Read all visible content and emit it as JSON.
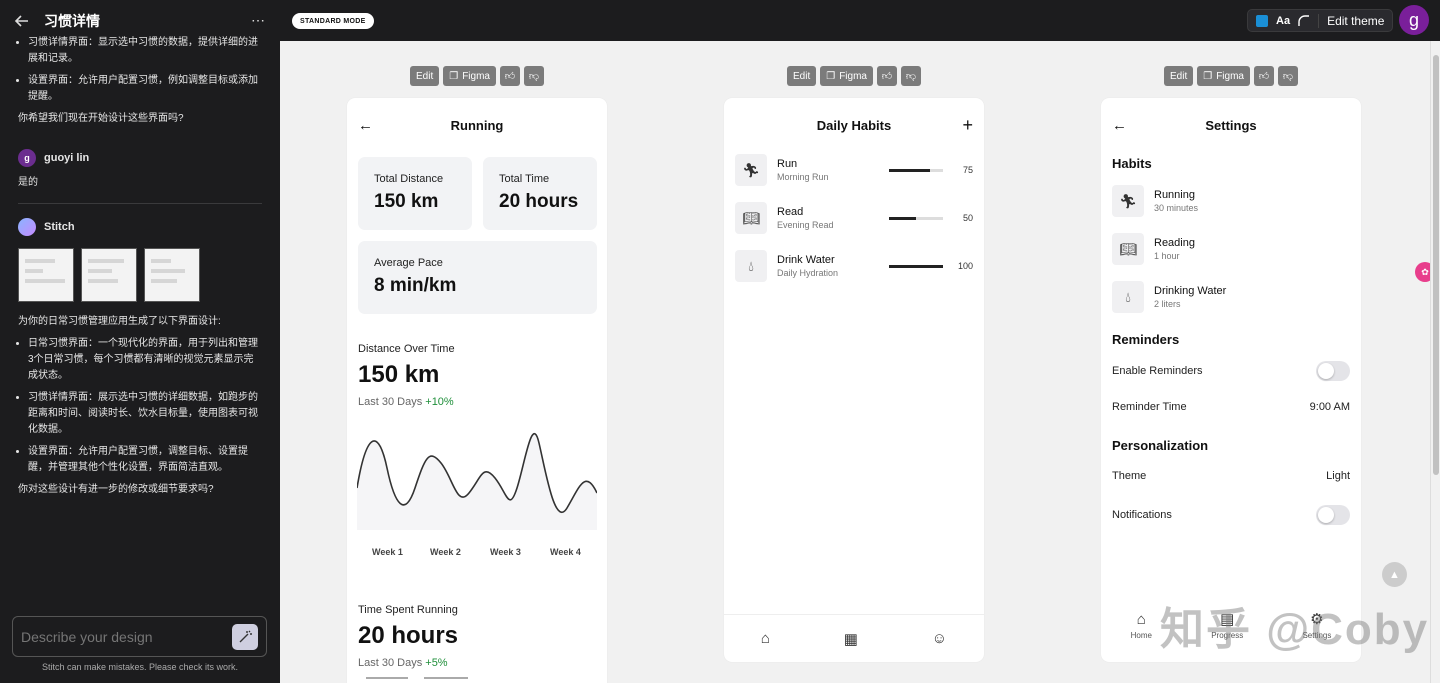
{
  "left_panel": {
    "title": "习惯详情",
    "chat_top": [
      "习惯详情界面：显示选中习惯的数据，提供详细的进展和记录。",
      "设置界面：允许用户配置习惯，例如调整目标或添加提醒。"
    ],
    "question1": "你希望我们现在开始设计这些界面吗?",
    "user_name": "guoyi lin",
    "user_initial": "g",
    "user_msg": "是的",
    "bot_name": "Stitch",
    "intro": "为你的日常习惯管理应用生成了以下界面设计:",
    "bullets": [
      "日常习惯界面：一个现代化的界面，用于列出和管理3个日常习惯，每个习惯都有清晰的视觉元素显示完成状态。",
      "习惯详情界面：展示选中习惯的详细数据，如跑步的距离和时间、阅读时长、饮水目标量，使用图表可视化数据。",
      "设置界面：允许用户配置习惯，调整目标、设置提醒，并管理其他个性化设置，界面简洁直观。"
    ],
    "question2": "你对这些设计有进一步的修改或细节要求吗?",
    "composer_placeholder": "Describe your design",
    "disclaimer": "Stitch can make mistakes. Please check its work."
  },
  "top": {
    "mode_label": "STANDARD MODE",
    "aa_label": "Aa",
    "edit_theme_label": "Edit theme",
    "avatar_initial": "g",
    "swatch_color": "#1a8fd6"
  },
  "toolbar": {
    "edit_label": "Edit",
    "figma_label": "Figma"
  },
  "running": {
    "title": "Running",
    "total_distance_label": "Total Distance",
    "total_distance": "150 km",
    "total_time_label": "Total Time",
    "total_time": "20 hours",
    "pace_label": "Average Pace",
    "pace": "8 min/km",
    "chart1_label": "Distance Over Time",
    "chart1_value": "150 km",
    "chart1_sub": "Last 30 Days",
    "chart1_delta": "+10%",
    "weeks": [
      "Week 1",
      "Week 2",
      "Week 3",
      "Week 4"
    ],
    "chart2_label": "Time Spent Running",
    "chart2_value": "20 hours",
    "chart2_sub": "Last 30 Days",
    "chart2_delta": "+5%"
  },
  "daily": {
    "title": "Daily Habits",
    "habits": [
      {
        "name": "Run",
        "detail": "Morning Run",
        "value": "75",
        "progress": 0.75,
        "icon": "run-icon"
      },
      {
        "name": "Read",
        "detail": "Evening Read",
        "value": "50",
        "progress": 0.5,
        "icon": "book-icon"
      },
      {
        "name": "Drink Water",
        "detail": "Daily Hydration",
        "value": "100",
        "progress": 1.0,
        "icon": "water-drop-icon"
      }
    ]
  },
  "settings": {
    "title": "Settings",
    "habits_header": "Habits",
    "habits": [
      {
        "name": "Running",
        "detail": "30 minutes"
      },
      {
        "name": "Reading",
        "detail": "1 hour"
      },
      {
        "name": "Drinking Water",
        "detail": "2 liters"
      }
    ],
    "reminders_header": "Reminders",
    "enable_reminders": "Enable Reminders",
    "reminder_time_label": "Reminder Time",
    "reminder_time": "9:00 AM",
    "personalization_header": "Personalization",
    "theme_label": "Theme",
    "theme_value": "Light",
    "notifications_label": "Notifications",
    "nav": [
      "Home",
      "Progress",
      "Settings"
    ]
  },
  "watermark": "知乎 @Coby"
}
